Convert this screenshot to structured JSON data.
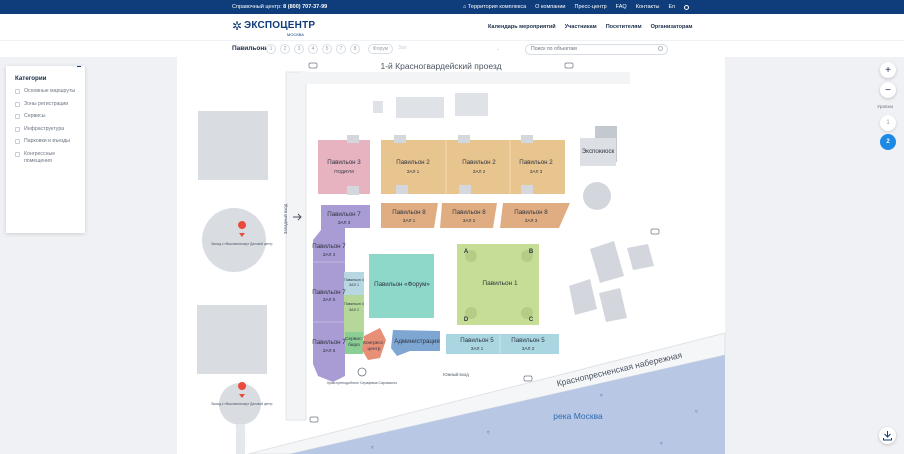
{
  "topbar": {
    "phone_label": "Справочный центр:",
    "phone_number": "8 (800) 707-37-99",
    "links": [
      "Территория комплекса",
      "О компании",
      "Пресс-центр",
      "FAQ",
      "Контакты",
      "En"
    ]
  },
  "header": {
    "logo_name": "ЭКСПОЦЕНТР",
    "logo_city": "МОСКВА",
    "nav": [
      "Календарь мероприятий",
      "Участникам",
      "Посетителям",
      "Организаторам"
    ]
  },
  "filter": {
    "pavilions_label": "Павильоны",
    "pavilion_numbers": [
      "1",
      "2",
      "3",
      "4",
      "5",
      "7",
      "8"
    ],
    "forum_label": "Форум",
    "hall_placeholder": "Зал",
    "search_placeholder": "Поиск по объектам"
  },
  "categories": {
    "title": "Категории",
    "items": [
      "Основные маршруты",
      "Зоны регистрации",
      "Сервисы",
      "Инфраструктура",
      "Парковки и въезды",
      "Конгрессные помещения"
    ]
  },
  "controls": {
    "zoom_in": "+",
    "zoom_out": "−",
    "levels_label": "Уровни",
    "levels": [
      "1",
      "2"
    ],
    "active_level": "2"
  },
  "map": {
    "street_top": "1-й Красногвардейский проезд",
    "street_embankment": "Краснопресненская набережная",
    "river": "река Москва",
    "west_entrance": "Западный вход",
    "south_entrance": "Южный вход",
    "church": "Храм преподобного Серафима Саровского",
    "metro_exit": "Выход к «Выставочному» Деловой центр",
    "halls": {
      "p3_name": "Павильон 3",
      "p3_sub": "ПОДИУМ",
      "p2_name": "Павильон 2",
      "p2_sub1": "ЗАЛ 1",
      "p2_sub2": "ЗАЛ 2",
      "p2_sub3": "ЗАЛ 3",
      "expo": "Экспокиоск",
      "p7_name": "Павильон 7",
      "p7_z3": "ЗАЛ 3",
      "p7_z4": "ЗАЛ 4",
      "p7_z5": "ЗАЛ 5",
      "p7_z6": "ЗАЛ 6",
      "p8_name": "Павильон 8",
      "p8_sub1": "ЗАЛ 1",
      "p8_sub2": "ЗАЛ 2",
      "p8_sub3": "ЗАЛ 3",
      "p4_name": "Павильон 4",
      "p4_sub1": "ЗАЛ 1",
      "p4_sub2": "ЗАЛ 2",
      "forum": "Павильон «Форум»",
      "p1_name": "Павильон 1",
      "corner_a": "A",
      "corner_b": "B",
      "corner_c": "C",
      "corner_d": "D",
      "service_bureau_1": "Сервис-",
      "service_bureau_2": "бюро",
      "congress_1": "Конгресс-",
      "congress_2": "центр",
      "admin": "Администрация",
      "p5_name": "Павильон 5",
      "p5_sub1": "ЗАЛ 1",
      "p5_sub2": "ЗАЛ 2"
    }
  },
  "colors": {
    "brand": "#0f3c7a",
    "accent": "#1e88e5",
    "pavilion2": "#e8c58f",
    "pavilion3": "#e7b3c0",
    "pavilion7": "#a99bd3",
    "forum": "#8ed8c9",
    "pavilion1": "#c6dd95",
    "pavilion5": "#a9d6e1",
    "river": "#b7c7e4"
  }
}
